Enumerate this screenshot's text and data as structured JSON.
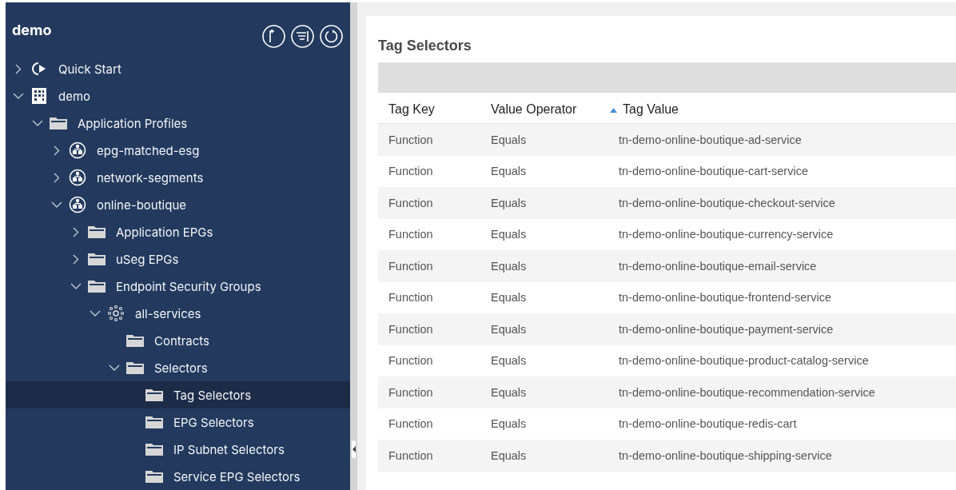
{
  "sidebar": {
    "title": "demo",
    "tree": [
      {
        "label": "Quick Start",
        "kind": "quickstart",
        "expanded": false,
        "selected": false
      },
      {
        "label": "demo",
        "kind": "tenant",
        "expanded": true,
        "selected": false,
        "children": [
          {
            "label": "Application Profiles",
            "kind": "folder",
            "expanded": true,
            "selected": false,
            "children": [
              {
                "label": "epg-matched-esg",
                "kind": "app",
                "expanded": false,
                "selected": false
              },
              {
                "label": "network-segments",
                "kind": "app",
                "expanded": false,
                "selected": false
              },
              {
                "label": "online-boutique",
                "kind": "app",
                "expanded": true,
                "selected": false,
                "children": [
                  {
                    "label": "Application EPGs",
                    "kind": "folder",
                    "expanded": false,
                    "selected": false
                  },
                  {
                    "label": "uSeg EPGs",
                    "kind": "folder",
                    "expanded": false,
                    "selected": false
                  },
                  {
                    "label": "Endpoint Security Groups",
                    "kind": "folder",
                    "expanded": true,
                    "selected": false,
                    "children": [
                      {
                        "label": "all-services",
                        "kind": "esg",
                        "expanded": true,
                        "selected": false,
                        "children": [
                          {
                            "label": "Contracts",
                            "kind": "folder",
                            "selected": false
                          },
                          {
                            "label": "Selectors",
                            "kind": "folder",
                            "expanded": true,
                            "selected": false,
                            "children": [
                              {
                                "label": "Tag Selectors",
                                "kind": "folder",
                                "selected": true
                              },
                              {
                                "label": "EPG Selectors",
                                "kind": "folder",
                                "selected": false
                              },
                              {
                                "label": "IP Subnet Selectors",
                                "kind": "folder",
                                "selected": false
                              },
                              {
                                "label": "Service EPG Selectors",
                                "kind": "folder",
                                "selected": false
                              }
                            ]
                          }
                        ]
                      }
                    ]
                  }
                ]
              }
            ]
          }
        ]
      }
    ]
  },
  "panel": {
    "title": "Tag Selectors",
    "table": {
      "columns": [
        {
          "label": "Tag Key",
          "sorted": false
        },
        {
          "label": "Value Operator",
          "sorted": false
        },
        {
          "label": "Tag Value",
          "sorted": true
        }
      ],
      "rows": [
        [
          "Function",
          "Equals",
          "tn-demo-online-boutique-ad-service"
        ],
        [
          "Function",
          "Equals",
          "tn-demo-online-boutique-cart-service"
        ],
        [
          "Function",
          "Equals",
          "tn-demo-online-boutique-checkout-service"
        ],
        [
          "Function",
          "Equals",
          "tn-demo-online-boutique-currency-service"
        ],
        [
          "Function",
          "Equals",
          "tn-demo-online-boutique-email-service"
        ],
        [
          "Function",
          "Equals",
          "tn-demo-online-boutique-frontend-service"
        ],
        [
          "Function",
          "Equals",
          "tn-demo-online-boutique-payment-service"
        ],
        [
          "Function",
          "Equals",
          "tn-demo-online-boutique-product-catalog-service"
        ],
        [
          "Function",
          "Equals",
          "tn-demo-online-boutique-recommendation-service"
        ],
        [
          "Function",
          "Equals",
          "tn-demo-online-boutique-redis-cart"
        ],
        [
          "Function",
          "Equals",
          "tn-demo-online-boutique-shipping-service"
        ]
      ]
    }
  }
}
